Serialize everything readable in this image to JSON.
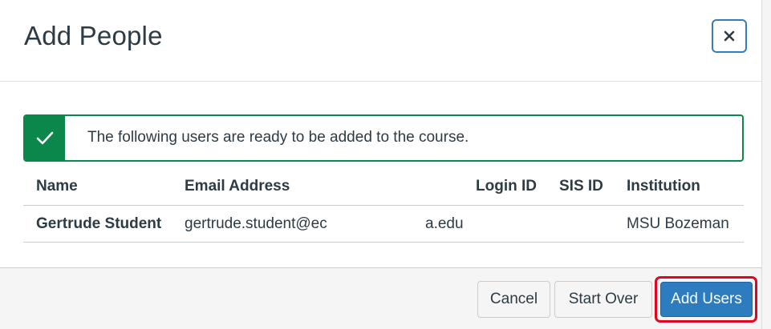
{
  "dialog": {
    "title": "Add People",
    "close_icon": "close-icon"
  },
  "alert": {
    "icon": "checkmark-icon",
    "message": "The following users are ready to be added to the course.",
    "color": "#0b874b"
  },
  "table": {
    "columns": [
      "Name",
      "Email Address",
      "Login ID",
      "SIS ID",
      "Institution"
    ],
    "rows": [
      {
        "name": "Gertrude Student",
        "email_visible_start": "gertrude.student@ec",
        "email_visible_end": "a.edu",
        "login_id": "",
        "sis_id": "",
        "institution": "MSU Bozeman"
      }
    ]
  },
  "footer": {
    "cancel_label": "Cancel",
    "start_over_label": "Start Over",
    "add_users_label": "Add Users",
    "primary_color": "#2d7cc0",
    "highlight_color": "#e0061f"
  }
}
